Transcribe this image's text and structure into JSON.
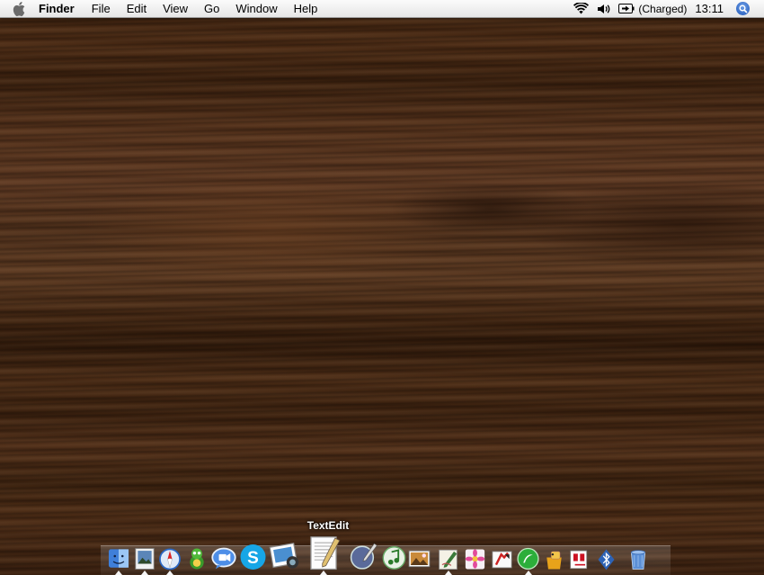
{
  "menubar": {
    "app_name": "Finder",
    "menus": [
      "File",
      "Edit",
      "View",
      "Go",
      "Window",
      "Help"
    ],
    "battery_status": "(Charged)",
    "clock": "13:11"
  },
  "desktop": {
    "wallpaper": "wood-grain",
    "colors": {
      "wood_dark": "#2f190a",
      "wood_mid": "#4a2a14",
      "wood_light": "#5a3620"
    }
  },
  "dock": {
    "tooltip": "TextEdit",
    "items": [
      {
        "icon": "finder-icon",
        "running": true
      },
      {
        "icon": "preview-icon",
        "running": true
      },
      {
        "icon": "safari-icon",
        "running": true
      },
      {
        "icon": "adium-icon",
        "running": false
      },
      {
        "icon": "ichat-icon",
        "running": false
      },
      {
        "icon": "skype-icon",
        "running": false
      },
      {
        "icon": "iphoto-icon",
        "running": false
      },
      {
        "icon": "textedit-icon",
        "running": true
      },
      {
        "icon": "script-editor-icon",
        "running": false
      },
      {
        "icon": "itunes-icon",
        "running": false
      },
      {
        "icon": "photo-app-icon",
        "running": false
      },
      {
        "icon": "pen-app-icon",
        "running": true
      },
      {
        "icon": "flower-app-icon",
        "running": false
      },
      {
        "icon": "transmit-app-icon",
        "running": false
      },
      {
        "icon": "dreamweaver-icon",
        "running": true
      },
      {
        "icon": "stuffit-icon",
        "running": false
      },
      {
        "icon": "pdf-app-icon",
        "running": false
      },
      {
        "icon": "bluetooth-icon",
        "running": false
      },
      {
        "icon": "trash-icon",
        "running": false
      }
    ]
  }
}
